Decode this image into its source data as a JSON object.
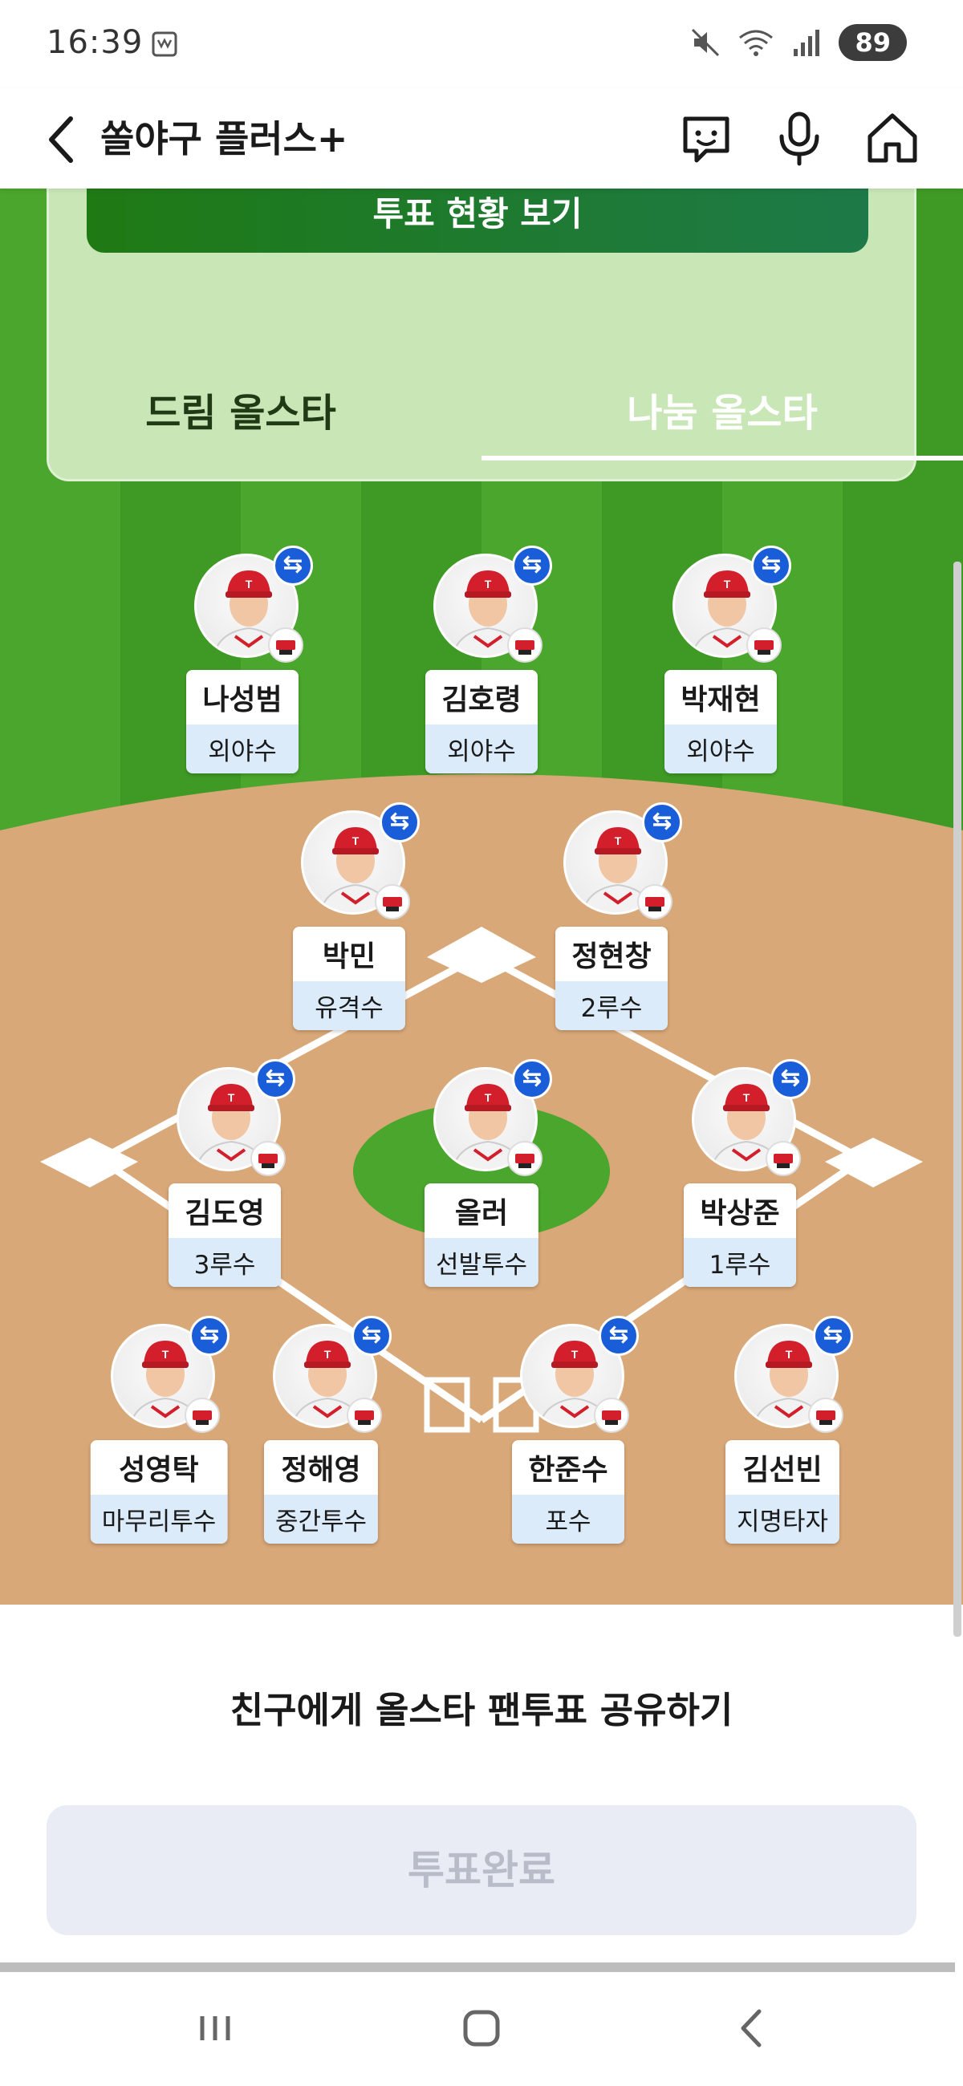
{
  "status_bar": {
    "time": "16:39",
    "battery": "89"
  },
  "header": {
    "title": "쏠야구 플러스+"
  },
  "vote_status_button": "투표 현황 보기",
  "tabs": [
    {
      "label": "드림 올스타",
      "selected": false
    },
    {
      "label": "나눔 올스타",
      "selected": true
    }
  ],
  "players": [
    {
      "name": "나성범",
      "position": "외야수"
    },
    {
      "name": "김호령",
      "position": "외야수"
    },
    {
      "name": "박재현",
      "position": "외야수"
    },
    {
      "name": "박민",
      "position": "유격수"
    },
    {
      "name": "정현창",
      "position": "2루수"
    },
    {
      "name": "김도영",
      "position": "3루수"
    },
    {
      "name": "올러",
      "position": "선발투수"
    },
    {
      "name": "박상준",
      "position": "1루수"
    },
    {
      "name": "성영탁",
      "position": "마무리투수"
    },
    {
      "name": "정해영",
      "position": "중간투수"
    },
    {
      "name": "한준수",
      "position": "포수"
    },
    {
      "name": "김선빈",
      "position": "지명타자"
    }
  ],
  "share_text": "친구에게 올스타 팬투표 공유하기",
  "vote_done_button": "투표완료",
  "colors": {
    "accent_blue": "#1a5dd8",
    "field_green": "#4aa62c",
    "infield_dirt": "#d9a878",
    "team_red": "#d21f2b"
  },
  "icons": [
    "back-arrow-icon",
    "chat-bot-icon",
    "microphone-icon",
    "home-icon",
    "swap-icon",
    "recents-icon",
    "home-nav-icon",
    "back-nav-icon"
  ]
}
